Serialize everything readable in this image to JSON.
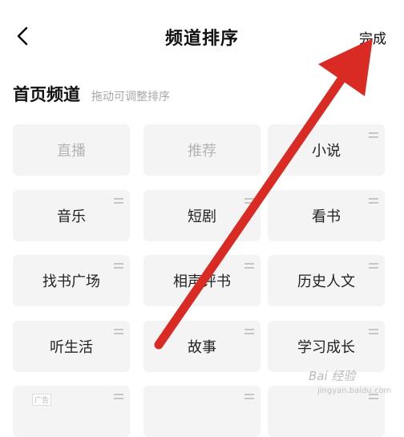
{
  "header": {
    "title": "频道排序",
    "done_label": "完成"
  },
  "section": {
    "title": "首页频道",
    "hint": "拖动可调整排序"
  },
  "channels": [
    {
      "label": "直播",
      "fixed": true
    },
    {
      "label": "推荐",
      "fixed": true
    },
    {
      "label": "小说",
      "fixed": false
    },
    {
      "label": "音乐",
      "fixed": false
    },
    {
      "label": "短剧",
      "fixed": false
    },
    {
      "label": "看书",
      "fixed": false
    },
    {
      "label": "找书广场",
      "fixed": false
    },
    {
      "label": "相声评书",
      "fixed": false
    },
    {
      "label": "历史人文",
      "fixed": false
    },
    {
      "label": "听生活",
      "fixed": false
    },
    {
      "label": "故事",
      "fixed": false
    },
    {
      "label": "学习成长",
      "fixed": false
    }
  ],
  "annotation": {
    "color": "#d92a24"
  },
  "watermark": {
    "ad_tag": "广告",
    "logo": "Bai 经验",
    "sub": "jingyan.baidu.com"
  }
}
